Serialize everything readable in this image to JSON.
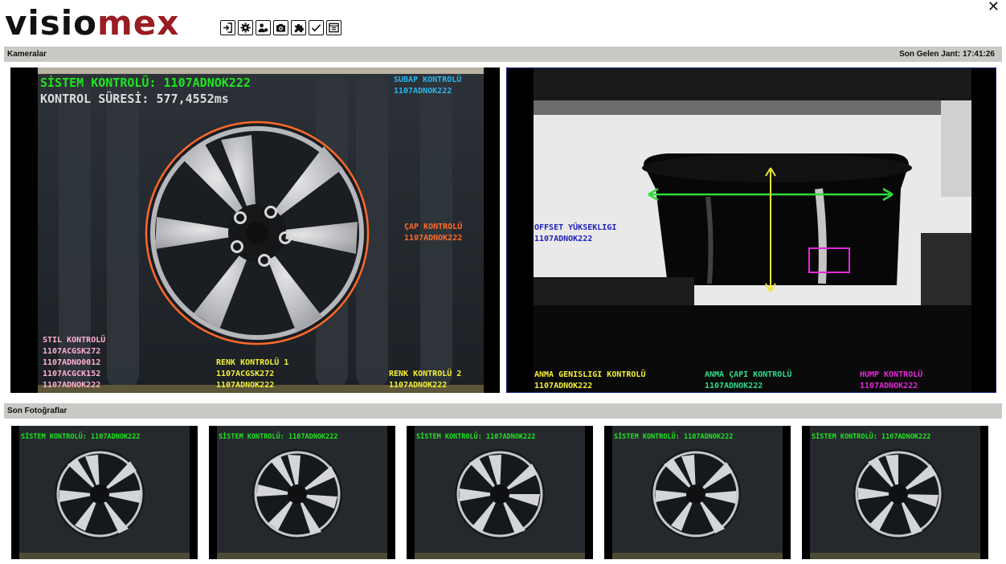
{
  "logo": {
    "part1": "visio",
    "part2": "mex"
  },
  "toolbar": {
    "buttons": [
      {
        "name": "login-icon"
      },
      {
        "name": "gear-icon"
      },
      {
        "name": "users-icon"
      },
      {
        "name": "camera-icon"
      },
      {
        "name": "puzzle-icon"
      },
      {
        "name": "check-icon"
      },
      {
        "name": "window-icon"
      }
    ]
  },
  "close_label": "✕",
  "cameras_section": {
    "title": "Kameralar",
    "last_label": "Son Gelen Jant: 17:41:26"
  },
  "camera1": {
    "title_line": "SİSTEM KONTROLÜ: 1107ADNOK222",
    "time_line": "KONTROL SÜRESİ: 577,4552ms",
    "subap": {
      "label": "SUBAP KONTROLÜ",
      "value": "1107ADNOK222"
    },
    "cap": {
      "label": "ÇAP KONTROLÜ",
      "value": "1107ADNOK222"
    },
    "stil": {
      "label": "STIL KONTROLÜ",
      "values": [
        "1107ACGSK272",
        "1107ADNO0012",
        "1107ACGCK152",
        "1107ADNOK222"
      ]
    },
    "renk1": {
      "label": "RENK KONTROLÜ 1",
      "values": [
        "1107ACGSK272",
        "1107ADNOK222"
      ]
    },
    "renk2": {
      "label": "RENK KONTROLÜ 2",
      "value": "1107ADNOK222"
    }
  },
  "camera2": {
    "offset": {
      "label": "OFFSET YÜKSEKLIGI",
      "value": "1107ADNOK222"
    },
    "anma_gen": {
      "label": "ANMA GENISLIGI KONTROLÜ",
      "value": "1107ADNOK222"
    },
    "anma_cap": {
      "label": "ANMA ÇAPI KONTROLÜ",
      "value": "1107ADNOK222"
    },
    "hump": {
      "label": "HUMP KONTROLÜ",
      "value": "1107ADNOK222"
    }
  },
  "photos_section": {
    "title": "Son Fotoğraflar"
  },
  "thumbnails": [
    {
      "caption": "SİSTEM KONTROLÜ: 1107ADNOK222"
    },
    {
      "caption": "SİSTEM KONTROLÜ: 1107ADNOK222"
    },
    {
      "caption": "SİSTEM KONTROLÜ: 1107ADNOK222"
    },
    {
      "caption": "SİSTEM KONTROLÜ: 1107ADNOK222"
    },
    {
      "caption": "SİSTEM KONTROLÜ: 1107ADNOK222"
    }
  ],
  "colors": {
    "brand_red": "#9b1c22",
    "green_overlay": "#1ee61e",
    "cyan_overlay": "#2ab6ee",
    "orange_overlay": "#ff6a2a",
    "pink_overlay": "#ffb0d0",
    "yellow_overlay": "#f4ef3a",
    "blue_overlay": "#2020c0",
    "magenta_overlay": "#e02ad8"
  }
}
